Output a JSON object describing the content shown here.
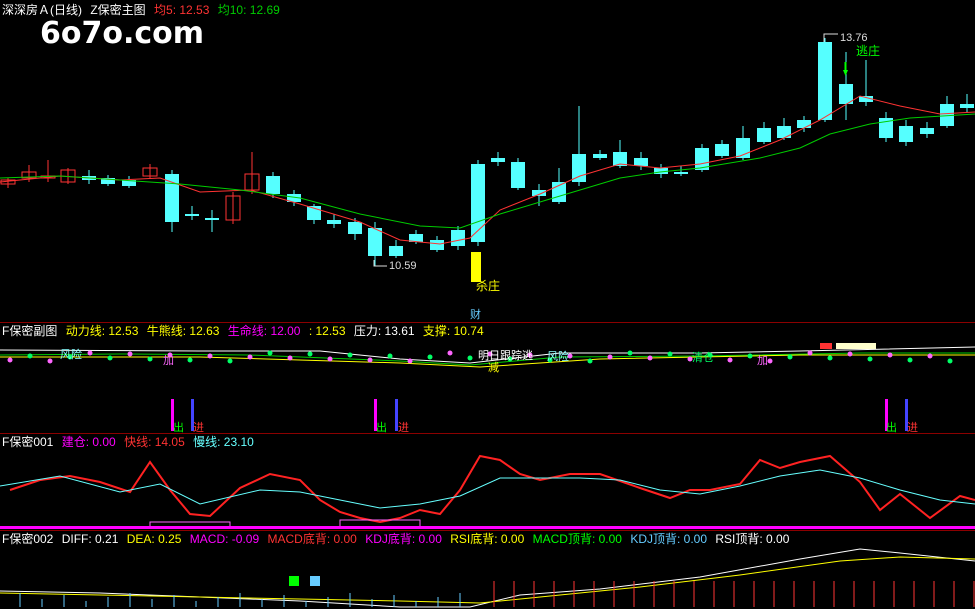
{
  "main": {
    "stock_name": "深深房Ａ(日线)",
    "indicator_name": "Z保密主图",
    "ma5_label": "均5: 12.53",
    "ma10_label": "均10: 12.69",
    "watermark": "6o7o.com",
    "annotations": {
      "high": "13.76",
      "low": "10.59",
      "escape": "逃庄",
      "kill": "杀庄",
      "cai": "财"
    }
  },
  "sub1": {
    "name": "F保密副图",
    "items": [
      {
        "label": "动力线: 12.53",
        "color": "#ffff00"
      },
      {
        "label": "牛熊线: 12.63",
        "color": "#ffff00"
      },
      {
        "label": "生命线: 12.00",
        "color": "#ff00ff"
      },
      {
        "label": ": 12.53",
        "color": "#ffff00"
      },
      {
        "label": "压力: 13.61",
        "color": "#ffffff"
      },
      {
        "label": "支撑: 10.74",
        "color": "#ffff00"
      }
    ],
    "markers": {
      "fengxian": "风险",
      "jia": "加",
      "mingri": "明日跟踪逃",
      "jian": "减",
      "qingcang": "清仓",
      "chu": "出",
      "jin": "进"
    }
  },
  "sub2": {
    "name": "F保密001",
    "items": [
      {
        "label": "建仓: 0.00",
        "color": "#ff00ff"
      },
      {
        "label": "快线: 14.05",
        "color": "#ff3333"
      },
      {
        "label": "慢线: 23.10",
        "color": "#66ffff"
      }
    ]
  },
  "sub3": {
    "name": "F保密002",
    "items": [
      {
        "label": "DIFF: 0.21",
        "color": "#ffffff"
      },
      {
        "label": "DEA: 0.25",
        "color": "#ffff00"
      },
      {
        "label": "MACD: -0.09",
        "color": "#ff00ff"
      },
      {
        "label": "MACD底背: 0.00",
        "color": "#ff3333"
      },
      {
        "label": "KDJ底背: 0.00",
        "color": "#ff00ff"
      },
      {
        "label": "RSI底背: 0.00",
        "color": "#ffff00"
      },
      {
        "label": "MACD顶背: 0.00",
        "color": "#00ff00"
      },
      {
        "label": "KDJ顶背: 0.00",
        "color": "#66ccff"
      },
      {
        "label": "RSI顶背: 0.00",
        "color": "#ffffff"
      }
    ]
  },
  "colors": {
    "up": "#ff3333",
    "down": "#55ffff",
    "ma5": "#ff3333",
    "ma10": "#00cc00",
    "separator": "#8b0000"
  }
}
